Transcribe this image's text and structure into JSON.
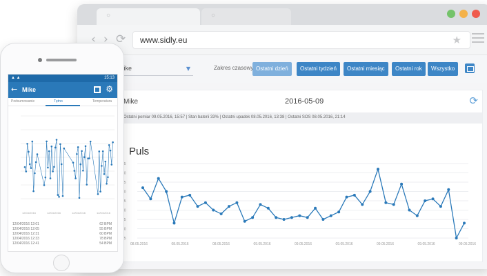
{
  "browser": {
    "url": "www.sidly.eu",
    "nav": {
      "back": "‹",
      "forward": "›",
      "reload": "⟳"
    },
    "star_icon": "star-icon"
  },
  "filters": {
    "selected_user": "Mike",
    "range_label": "Zakres czasowy",
    "buttons": [
      "Ostatni dzień",
      "Ostatni tydzień",
      "Ostatni miesiąc",
      "Ostatni rok",
      "Wszystko"
    ],
    "active_button": "Ostatni dzień",
    "accent_color": "#3d86c6"
  },
  "panel": {
    "name": "Mike",
    "date": "2016-05-09",
    "info": "Ostatni pomiar 09.05.2016, 15:57 | Stan baterii 33% | Ostatni upadek 08.05.2016, 13:38 | Ostatni SOS 08.05.2016, 21:14"
  },
  "chart_data": {
    "type": "line",
    "title": "Puls",
    "ylim": [
      45,
      85
    ],
    "y_ticks": [
      "85",
      "80",
      "75",
      "70",
      "65",
      "60",
      "55",
      "50",
      "45"
    ],
    "x_ticks": [
      "08.05.2016",
      "08.05.2016",
      "08.05.2016",
      "09.05.2016",
      "09.05.2016",
      "09.05.2016",
      "09.05.2016",
      "09.05.2016",
      "09.05.2016"
    ],
    "values": [
      72,
      66,
      77,
      70,
      53,
      67,
      68,
      62,
      64,
      60,
      58,
      62,
      64,
      54,
      56,
      63,
      61,
      56,
      55,
      56,
      57,
      56,
      61,
      55,
      57,
      59,
      67,
      68,
      63,
      70,
      82,
      64,
      63,
      74,
      60,
      57,
      65,
      66,
      62,
      71,
      45,
      53
    ],
    "color": "#2a79b9",
    "grid": true
  },
  "phone": {
    "status_left": "▲ ▲",
    "status_right": "15:13",
    "title": "Mike",
    "tabs": [
      "Podsumowanie",
      "Tętno",
      "Temperatura"
    ],
    "active_tab": "Tętno",
    "chart_ticks": [
      "12/04/2016",
      "12/04/2016",
      "12/04/2016",
      "12/04/2016"
    ],
    "rows": [
      {
        "time": "12/04/2016 12:01",
        "value": "62 BPM"
      },
      {
        "time": "12/04/2016 12:05",
        "value": "55 BPM"
      },
      {
        "time": "12/04/2016 12:31",
        "value": "60 BPM"
      },
      {
        "time": "12/04/2016 12:33",
        "value": "78 BPM"
      },
      {
        "time": "12/04/2016 12:41",
        "value": "54 BPM"
      }
    ]
  }
}
